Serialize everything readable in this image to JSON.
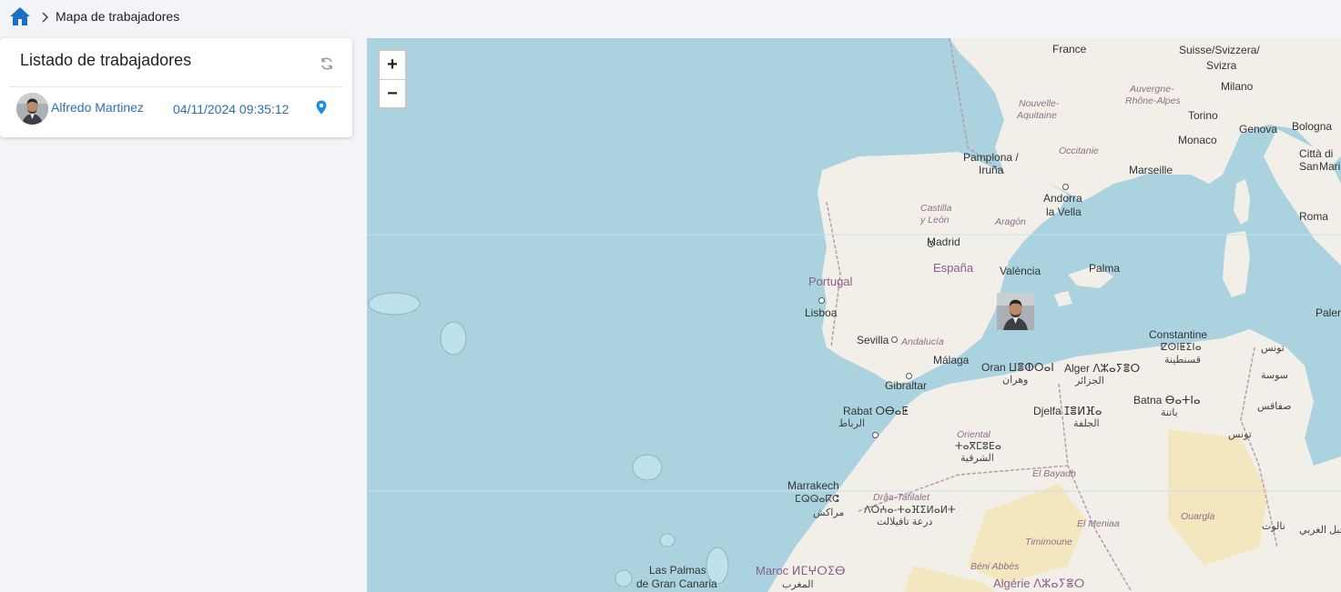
{
  "breadcrumb": {
    "home_icon": "home-icon",
    "separator_icon": "chevron-right-icon",
    "current": "Mapa de trabajadores"
  },
  "panel": {
    "title": "Listado de trabajadores",
    "refresh_icon": "refresh-icon",
    "workers": [
      {
        "name": "Alfredo Martinez",
        "timestamp": "04/11/2024 09:35:12",
        "location_icon": "map-pin-icon"
      }
    ]
  },
  "map": {
    "zoom_in": "+",
    "zoom_out": "−",
    "labels": {
      "france": "France",
      "suisse": "Suisse/Svizzera/",
      "svizra": "Svizra",
      "nouvelle": "Nouvelle-",
      "aquitaine": "Aquitaine",
      "auvergne": "Auvergne-",
      "rhone": "Rhône-Alpes",
      "milano": "Milano",
      "torino": "Torino",
      "genova": "Genova",
      "bologna": "Bologna",
      "monaco": "Monaco",
      "occitanie": "Occitanie",
      "pamplona": "Pamplona /",
      "iruna": "Iruña",
      "marseille": "Marseille",
      "citta": "Città di",
      "sanmarino": "San",
      "marino": "Marino",
      "andorra": "Andorra",
      "lavella": "la Vella",
      "castilla": "Castilla",
      "yleon": "y León",
      "aragon": "Aragón",
      "roma": "Roma",
      "madrid": "Madrid",
      "espana": "España",
      "valencia": "València",
      "palma": "Palma",
      "portugal": "Portugal",
      "lisboa": "Lisboa",
      "palermo": "Palerı",
      "sevilla": "Sevilla",
      "andalucia": "Andalucía",
      "constantine": "Constantine",
      "constantine_tf": "ⵇⵙⵏⵟⵉⵏⴰ",
      "constantine_ar": "قسنطينة",
      "tunis_ar": "تونس",
      "malaga": "Málaga",
      "oran": "Oran ⵡⴻⵀⵔⴰⵏ",
      "oran_ar": "وهران",
      "alger": "Alger ⴷⵣⴰⵢⴻⵔ",
      "alger_ar": "الجزائر",
      "sousse_ar": "سوسة",
      "gibraltar": "Gibraltar",
      "batna": "Batna ⴱⴰⵜⵏⴰ",
      "batna_ar": "باتنة",
      "sfax_ar": "صفاقس",
      "rabat": "Rabat ⵔⴱⴰⵟ",
      "rabat_ar": "الرباط",
      "djelfa": "Djelfa ⵊⴻⵍⴼⴰ",
      "djelfa_ar": "الجلفة",
      "tunisie_ar": "تونس",
      "oriental": "Oriental",
      "oriental_tf": "ⵜⴰⴳⵎⵓⴹⴰ",
      "oriental_ar": "الشرقية",
      "elbayadh": "El Bayadh",
      "marrakech": "Marrakech",
      "marrakech_tf": "ⵎⵕⵕⴰⴽⵛ",
      "marrakech_ar": "مراكش",
      "draa": "Drâa-Tafilalet",
      "draa_tf": "ⴷⵔⵄⴰ-ⵜⴰⴼⵉⵍⴰⵍⵜ",
      "draa_ar": "درعة تافيلالت",
      "elmeniaa": "El Meniaa",
      "ouargla": "Ouargla",
      "nalut_ar": "نالوت",
      "gharbi_ar": "الجبل الغربي",
      "timimoune": "Timimoune",
      "laspalmas": "Las Palmas",
      "grancanaria": "de Gran Canaria",
      "maroc": "Maroc ⵍⵎⵖⵔⵉⴱ",
      "maroc_ar": "المغرب",
      "beniabbes": "Béni Abbès",
      "algerie": "Algérie ⴷⵣⴰⵢⴻⵔ"
    }
  },
  "colors": {
    "sea": "#aad3df",
    "land": "#f2efe9",
    "desert": "#f4e6be",
    "accent": "#2a6fb8",
    "pin": "#1a8de8"
  }
}
